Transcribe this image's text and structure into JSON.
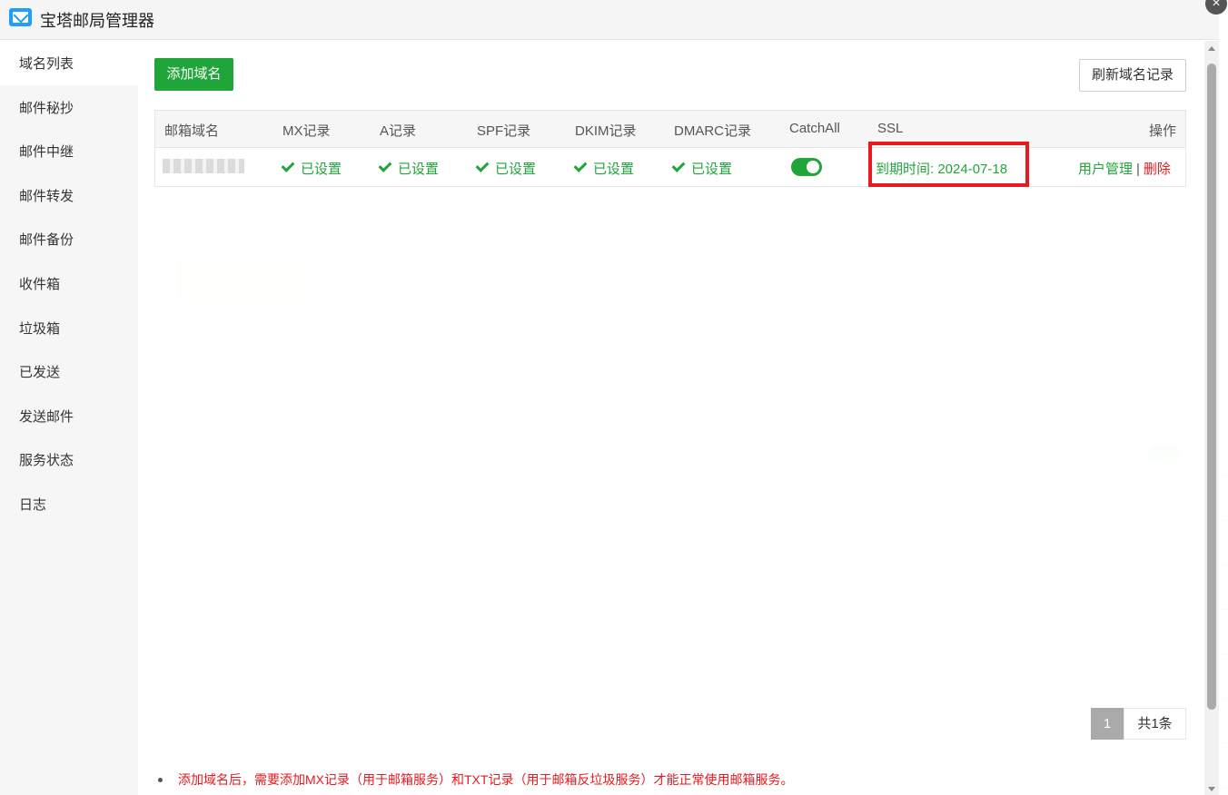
{
  "app": {
    "title": "宝塔邮局管理器"
  },
  "sidebar": {
    "items": [
      {
        "label": "域名列表"
      },
      {
        "label": "邮件秘抄"
      },
      {
        "label": "邮件中继"
      },
      {
        "label": "邮件转发"
      },
      {
        "label": "邮件备份"
      },
      {
        "label": "收件箱"
      },
      {
        "label": "垃圾箱"
      },
      {
        "label": "已发送"
      },
      {
        "label": "发送邮件"
      },
      {
        "label": "服务状态"
      },
      {
        "label": "日志"
      }
    ]
  },
  "toolbar": {
    "add_label": "添加域名",
    "refresh_label": "刷新域名记录"
  },
  "table": {
    "headers": {
      "domain": "邮箱域名",
      "mx": "MX记录",
      "a": "A记录",
      "spf": "SPF记录",
      "dkim": "DKIM记录",
      "dmarc": "DMARC记录",
      "catchall": "CatchAll",
      "ssl": "SSL",
      "ops": "操作"
    },
    "row": {
      "mx": "已设置",
      "a": "已设置",
      "spf": "已设置",
      "dkim": "已设置",
      "dmarc": "已设置",
      "catchall_on": true,
      "ssl": "到期时间: 2024-07-18",
      "user_manage": "用户管理",
      "sep": "|",
      "delete": "删除"
    }
  },
  "pagination": {
    "current": "1",
    "total": "共1条"
  },
  "tip": "添加域名后，需要添加MX记录（用于邮箱服务）和TXT记录（用于邮箱反垃圾服务）才能正常使用邮箱服务。",
  "close_icon": "×",
  "colors": {
    "accent": "#20a53a",
    "danger": "#e8191f",
    "icon_blue": "#1e9fff"
  }
}
